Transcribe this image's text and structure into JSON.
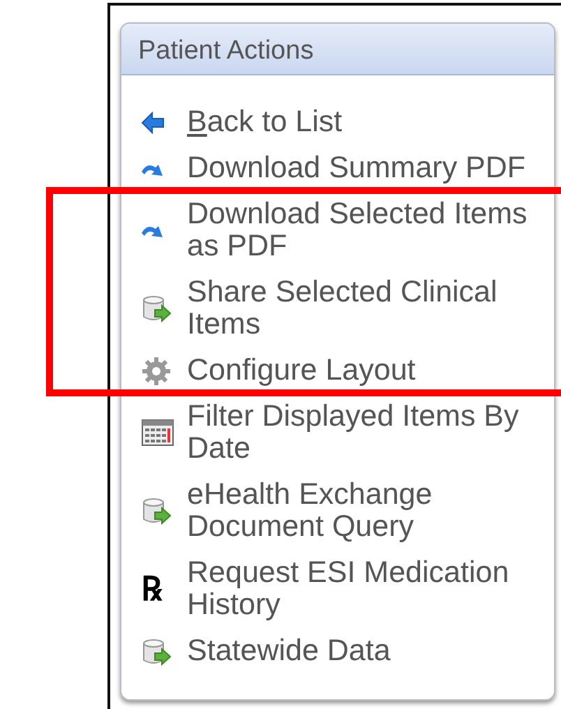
{
  "panel": {
    "title": "Patient Actions"
  },
  "actions": [
    {
      "kind": "back",
      "mnemonic": "B",
      "label": "ack to List"
    },
    {
      "kind": "download",
      "label": "Download Summary PDF"
    },
    {
      "kind": "download",
      "label": "Download Selected Items as PDF"
    },
    {
      "kind": "share",
      "label": "Share Selected Clinical Items"
    },
    {
      "kind": "settings",
      "label": "Configure Layout"
    },
    {
      "kind": "calendar",
      "label": "Filter Displayed Items By Date"
    },
    {
      "kind": "share",
      "label": "eHealth Exchange Document Query"
    },
    {
      "kind": "rx",
      "glyph": "℞",
      "label": "Request ESI Medication History"
    },
    {
      "kind": "share",
      "label": "Statewide Data"
    }
  ],
  "highlight": {
    "kind": "frame",
    "color": "#ff0000"
  }
}
